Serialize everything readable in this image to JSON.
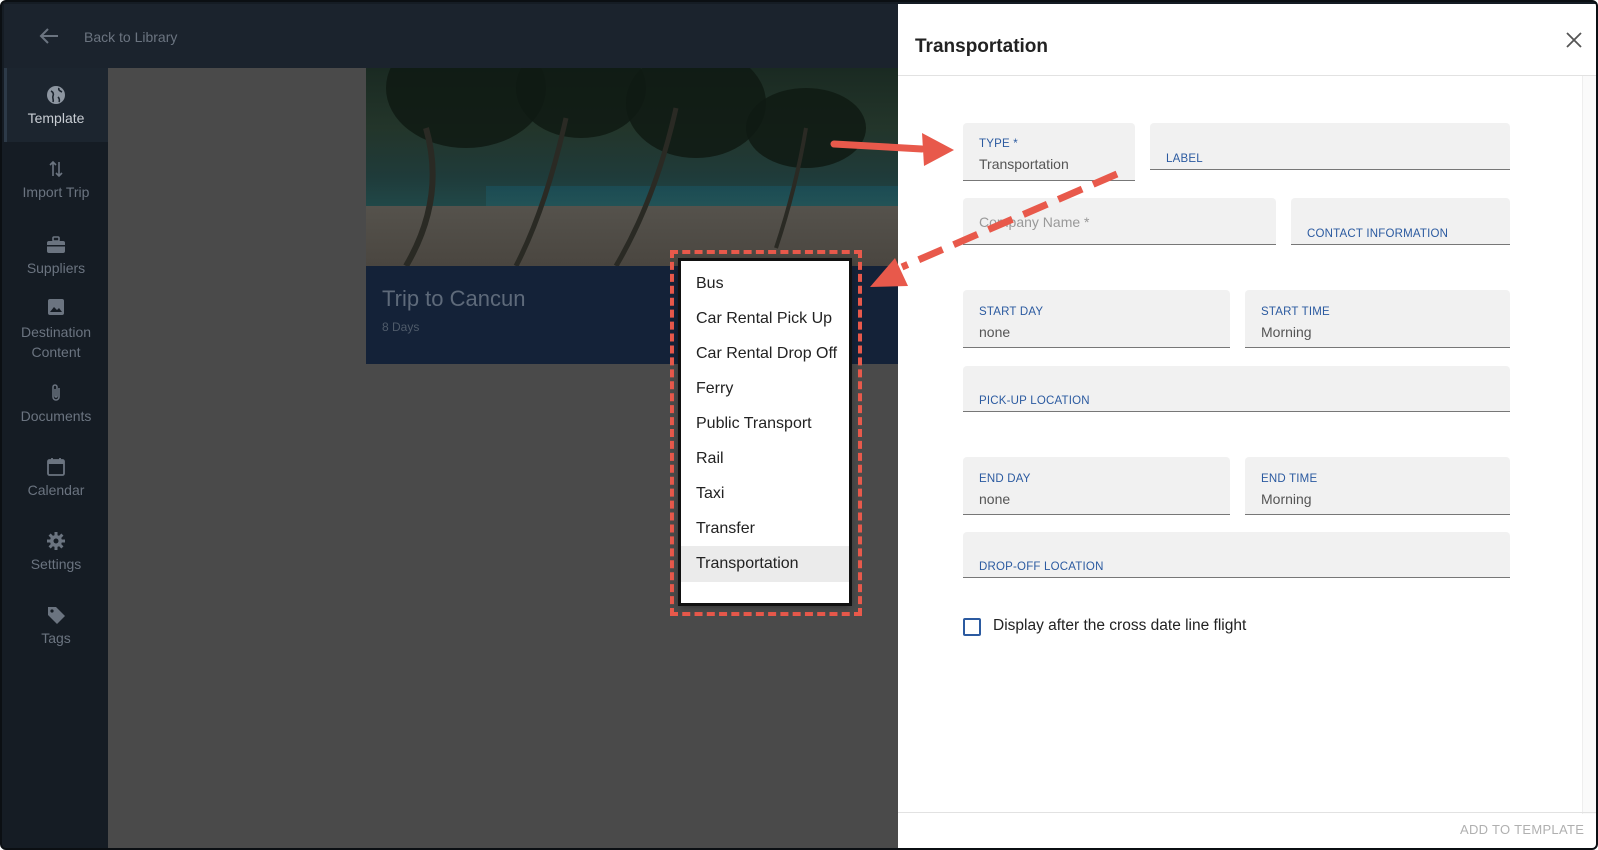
{
  "topbar": {
    "back_label": "Back to Library"
  },
  "sidebar": {
    "items": [
      {
        "label": "Template",
        "icon": "globe-icon"
      },
      {
        "label": "Import Trip",
        "icon": "import-arrows-icon"
      },
      {
        "label": "Suppliers",
        "icon": "briefcase-icon"
      },
      {
        "label": "Destination Content",
        "icon": "image-icon"
      },
      {
        "label": "Documents",
        "icon": "paperclip-icon"
      },
      {
        "label": "Calendar",
        "icon": "calendar-icon"
      },
      {
        "label": "Settings",
        "icon": "gear-icon"
      },
      {
        "label": "Tags",
        "icon": "tag-icon"
      }
    ]
  },
  "trip": {
    "title": "Trip to Cancun",
    "subtitle": "8 Days"
  },
  "menu": {
    "options": [
      "Bus",
      "Car Rental Pick Up",
      "Car Rental Drop Off",
      "Ferry",
      "Public Transport",
      "Rail",
      "Taxi",
      "Transfer",
      "Transportation"
    ],
    "selected": "Transportation"
  },
  "panel": {
    "title": "Transportation",
    "type": {
      "label": "TYPE *",
      "value": "Transportation"
    },
    "label_field": {
      "label": "LABEL"
    },
    "company": {
      "placeholder": "Company Name *"
    },
    "contact": {
      "label": "CONTACT INFORMATION"
    },
    "start_day": {
      "label": "START DAY",
      "value": "none"
    },
    "start_time": {
      "label": "START TIME",
      "value": "Morning"
    },
    "pickup": {
      "label": "PICK-UP LOCATION"
    },
    "end_day": {
      "label": "END DAY",
      "value": "none"
    },
    "end_time": {
      "label": "END TIME",
      "value": "Morning"
    },
    "dropoff": {
      "label": "DROP-OFF LOCATION"
    },
    "checkbox_label": "Display after the cross date line flight",
    "add_button": "ADD TO TEMPLATE"
  },
  "colors": {
    "accent": "#2b5aa0",
    "annotation": "#e8594b",
    "sidebar_bg": "#151c24"
  }
}
